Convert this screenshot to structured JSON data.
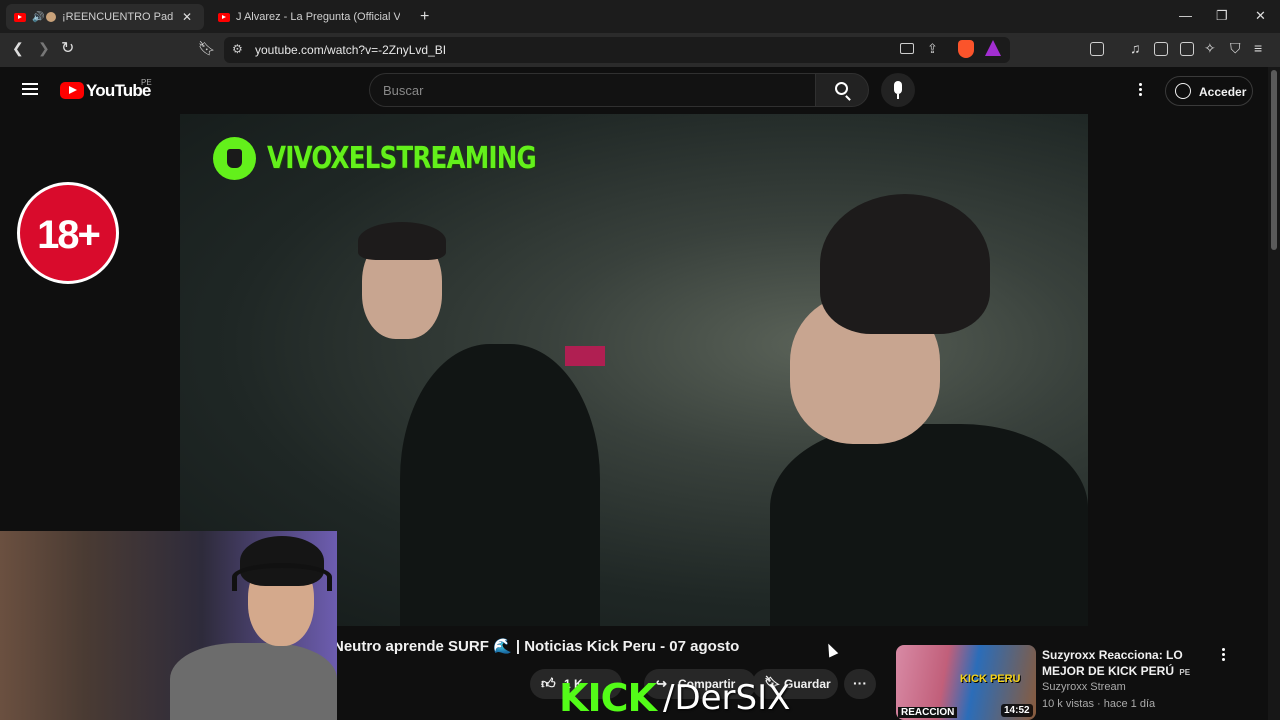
{
  "browser": {
    "tabs": [
      {
        "title": "¡REENCUENTRO Padre y S",
        "close": "✕"
      },
      {
        "title": "J Alvarez - La Pregunta (Official Video)"
      }
    ],
    "new_tab": "+",
    "url": "youtube.com/watch?v=-2ZnyLvd_BI",
    "window_controls": {
      "minimize": "—",
      "maximize": "❐",
      "close": "✕"
    }
  },
  "youtube": {
    "brand": "YouTube",
    "country_code": "PE",
    "search_placeholder": "Buscar",
    "signin_label": "Acceder"
  },
  "video": {
    "channel_overlay": "VIVOXELSTREAMING",
    "age_badge": "18+",
    "title": "Neutro aprende SURF 🌊 | Noticias Kick Peru - 07 agosto",
    "like_count": "1 K",
    "share_label": "Compartir",
    "save_label": "Guardar"
  },
  "stream_overlay": {
    "kick_logo": "KICK",
    "kick_handle": "/DerSIX"
  },
  "recommended": {
    "title": "Suzyroxx Reacciona: LO MEJOR DE KICK PERÚ",
    "country_code": "PE",
    "channel": "Suzyroxx Stream",
    "meta": "10 k vistas · hace 1 día",
    "duration": "14:52",
    "thumb_label": "REACCION",
    "thumb_text": "KICK PERU"
  },
  "colors": {
    "youtube_red": "#ff0000",
    "kick_green": "#53fc18",
    "age_badge_red": "#d90b2c"
  }
}
